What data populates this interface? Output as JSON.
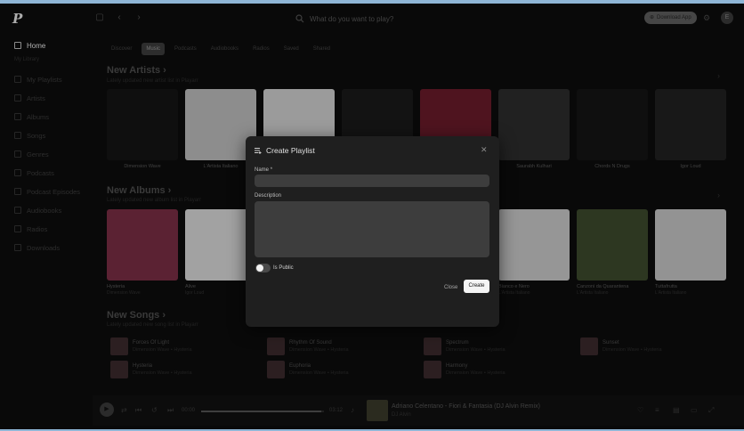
{
  "topbar": {
    "logo": "P",
    "search_placeholder": "What do you want to play?",
    "download_label": "Download App",
    "avatar_initial": "E"
  },
  "sidebar": {
    "home": "Home",
    "section_label": "My Library",
    "items": [
      "My Playlists",
      "Artists",
      "Albums",
      "Songs",
      "Genres",
      "Podcasts",
      "Podcast Episodes",
      "Audiobooks",
      "Radios",
      "Downloads"
    ]
  },
  "chips": [
    "Discover",
    "Music",
    "Podcasts",
    "Audiobooks",
    "Radios",
    "Saved",
    "Shared"
  ],
  "sections": {
    "new_artists": {
      "title": "New Artists",
      "subtitle": "Lately updated new artist list in Playarr"
    },
    "new_albums": {
      "title": "New Albums",
      "subtitle": "Lately updated new album list in Playarr"
    },
    "new_songs": {
      "title": "New Songs",
      "subtitle": "Lately updated new song list in Playarr"
    }
  },
  "artists": [
    {
      "name": "Dimension Wave",
      "color": "#141414"
    },
    {
      "name": "L'Artista Italiano",
      "color": "#bdbdbd"
    },
    {
      "name": "",
      "color": "#cfcfcf"
    },
    {
      "name": "",
      "color": "#1a1a1a"
    },
    {
      "name": "",
      "color": "#6a1b2a"
    },
    {
      "name": "Saurabh Kulhari",
      "color": "#2c2c2c"
    },
    {
      "name": "Chords N Drugs",
      "color": "#151515"
    },
    {
      "name": "Igor Loud",
      "color": "#202020"
    }
  ],
  "albums": [
    {
      "title": "Hysteria",
      "artist": "Dimension Wave",
      "color": "#7a2e44"
    },
    {
      "title": "Alive",
      "artist": "Igor Loud",
      "color": "#d9d9d9"
    },
    {
      "title": "Bianco e Nero",
      "artist": "L'Artista Italiano",
      "color": "#c8c8c8"
    },
    {
      "title": "Canzoni da Quarantena",
      "artist": "L'Artista Italiano",
      "color": "#3c4a2c"
    },
    {
      "title": "Tuttafrutta",
      "artist": "L'Artista Italiano",
      "color": "#c4c4c4"
    }
  ],
  "songs": [
    {
      "title": "Forces Of Light",
      "artist": "Dimension Wave",
      "album": "Hysteria"
    },
    {
      "title": "Rhythm Of Sound",
      "artist": "Dimension Wave",
      "album": "Hysteria"
    },
    {
      "title": "Spectrum",
      "artist": "Dimension Wave",
      "album": "Hysteria"
    },
    {
      "title": "Sunset",
      "artist": "Dimension Wave",
      "album": "Hysteria"
    },
    {
      "title": "Hysteria",
      "artist": "Dimension Wave",
      "album": "Hysteria"
    },
    {
      "title": "Euphoria",
      "artist": "Dimension Wave",
      "album": "Hysteria"
    },
    {
      "title": "Harmony",
      "artist": "Dimension Wave",
      "album": "Hysteria"
    }
  ],
  "player": {
    "elapsed": "00:00",
    "duration": "03:12",
    "progress": 0.98,
    "now_title": "Adriano Celentano - Fiori & Fantasia (DJ Alvin Remix)",
    "now_artist": "DJ Alvin"
  },
  "modal": {
    "title": "Create Playlist",
    "name_label": "Name",
    "name_required": "*",
    "name_value": "",
    "description_label": "Description",
    "description_value": "",
    "is_public_label": "Is Public",
    "is_public": false,
    "close_label": "Close",
    "create_label": "Create"
  }
}
